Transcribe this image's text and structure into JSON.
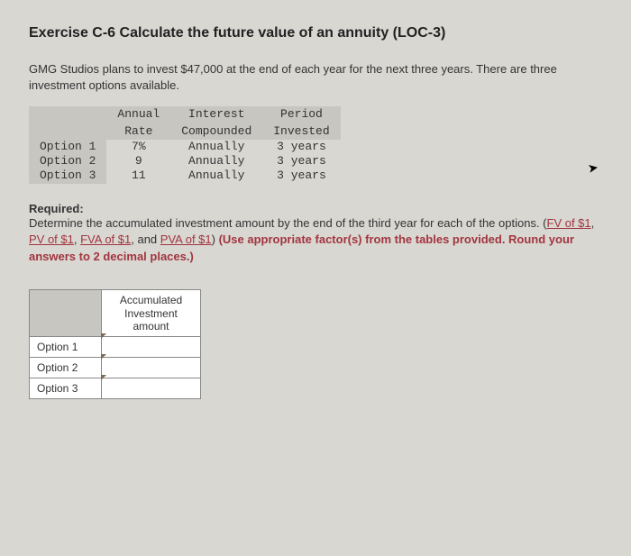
{
  "title": "Exercise C-6 Calculate the future value of an annuity (LOC-3)",
  "intro": "GMG Studios plans to invest $47,000 at the end of each year for the next three years. There are three investment options available.",
  "options_table": {
    "headers": {
      "rate_l1": "Annual",
      "rate_l2": "Rate",
      "comp_l1": "Interest",
      "comp_l2": "Compounded",
      "period_l1": "Period",
      "period_l2": "Invested"
    },
    "rows": [
      {
        "label": "Option 1",
        "rate": "7%",
        "comp": "Annually",
        "period": "3 years"
      },
      {
        "label": "Option 2",
        "rate": "9",
        "comp": "Annually",
        "period": "3 years"
      },
      {
        "label": "Option 3",
        "rate": "11",
        "comp": "Annually",
        "period": "3 years"
      }
    ]
  },
  "required": {
    "label": "Required:",
    "text_before": "Determine the accumulated investment amount by the end of the third year for each of the options. (",
    "links": {
      "fv": "FV of $1",
      "pv": "PV of $1",
      "fva": "FVA of $1",
      "pva": "PVA of $1"
    },
    "sep_comma": ", ",
    "sep_and": ", and ",
    "text_after_paren": ") ",
    "hint": "(Use appropriate factor(s) from the tables provided. Round your answers to 2 decimal places.)"
  },
  "answer_table": {
    "header_l1": "Accumulated",
    "header_l2": "Investment",
    "header_l3": "amount",
    "rows": [
      {
        "label": "Option 1"
      },
      {
        "label": "Option 2"
      },
      {
        "label": "Option 3"
      }
    ]
  }
}
